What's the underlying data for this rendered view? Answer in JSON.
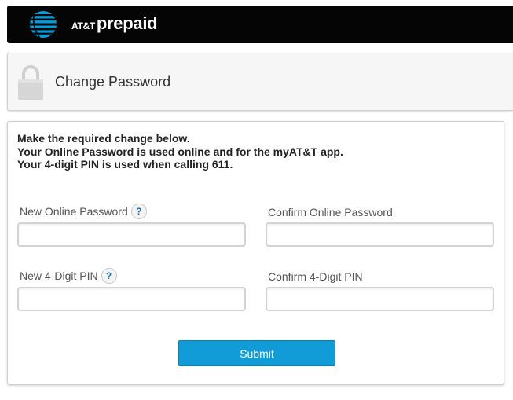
{
  "header": {
    "brand_att": "AT&T",
    "brand_prepaid": "prepaid",
    "logo_icon": "att-globe-icon",
    "background_color": "#050505"
  },
  "title_panel": {
    "title": "Change Password",
    "icon": "lock-icon"
  },
  "form": {
    "intro_lines": [
      "Make the required change below.",
      "Your Online Password is used online and for the myAT&T app.",
      "Your 4-digit PIN is used when calling 611."
    ],
    "fields": {
      "new_password": {
        "label": "New Online Password",
        "value": "",
        "help": "?"
      },
      "confirm_password": {
        "label": "Confirm Online Password",
        "value": ""
      },
      "new_pin": {
        "label": "New 4-Digit PIN",
        "value": "",
        "help": "?"
      },
      "confirm_pin": {
        "label": "Confirm 4-Digit PIN",
        "value": ""
      }
    },
    "submit_label": "Submit",
    "accent_color": "#119bd7"
  }
}
